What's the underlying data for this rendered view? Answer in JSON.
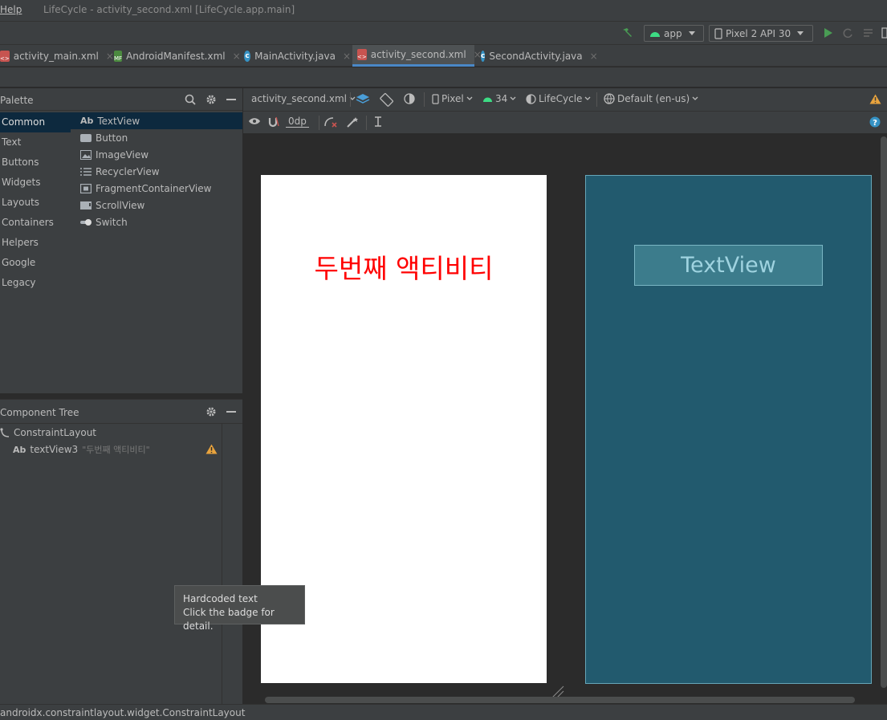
{
  "titlebar": {
    "menu_help": "Help",
    "window_title": "LifeCycle - activity_second.xml [LifeCycle.app.main]"
  },
  "runbar": {
    "module": "app",
    "device": "Pixel 2 API 30"
  },
  "tabs": [
    {
      "label": "activity_main.xml",
      "icon": "xml-layout-icon"
    },
    {
      "label": "AndroidManifest.xml",
      "icon": "manifest-icon"
    },
    {
      "label": "MainActivity.java",
      "icon": "class-icon"
    },
    {
      "label": "activity_second.xml",
      "icon": "xml-layout-icon",
      "active": true
    },
    {
      "label": "SecondActivity.java",
      "icon": "class-icon"
    }
  ],
  "palette": {
    "title": "Palette",
    "categories": [
      "Common",
      "Text",
      "Buttons",
      "Widgets",
      "Layouts",
      "Containers",
      "Helpers",
      "Google",
      "Legacy"
    ],
    "selected_category": "Common",
    "items": [
      {
        "label": "TextView",
        "prefix": "Ab"
      },
      {
        "label": "Button"
      },
      {
        "label": "ImageView"
      },
      {
        "label": "RecyclerView"
      },
      {
        "label": "FragmentContainerView"
      },
      {
        "label": "ScrollView"
      },
      {
        "label": "Switch"
      }
    ]
  },
  "component_tree": {
    "title": "Component Tree",
    "root": "ConstraintLayout",
    "child_prefix": "Ab",
    "child_id": "textView3",
    "child_text": "\"두번째 액티비티\""
  },
  "editor_toolbar": {
    "file": "activity_second.xml",
    "device": "Pixel",
    "api": "34",
    "theme": "LifeCycle",
    "locale": "Default (en-us)",
    "margin": "0dp"
  },
  "design": {
    "text": "두번째 액티비티",
    "text_color": "#ff0000"
  },
  "blueprint": {
    "label": "TextView"
  },
  "tooltip": {
    "line1": "Hardcoded text",
    "line2": "Click the badge for detail."
  },
  "statusbar": {
    "text": "androidx.constraintlayout.widget.ConstraintLayout"
  },
  "colors": {
    "accent": "#4a88c7",
    "blueprint_bg": "#225a6e",
    "warning": "#e8a33d",
    "run_green": "#499c54"
  }
}
